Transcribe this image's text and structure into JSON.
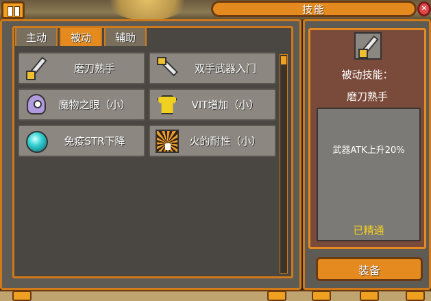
{
  "window": {
    "title": "技能"
  },
  "tabs": [
    {
      "label": "主动",
      "active": false
    },
    {
      "label": "被动",
      "active": true
    },
    {
      "label": "辅助",
      "active": false
    }
  ],
  "skills": [
    {
      "name": "磨刀熟手",
      "icon": "sword-icon"
    },
    {
      "name": "双手武器入门",
      "icon": "two-hand-sword-icon"
    },
    {
      "name": "魔物之眼（小）",
      "icon": "monster-eye-icon"
    },
    {
      "name": "VIT增加（小）",
      "icon": "shirt-icon"
    },
    {
      "name": "免疫STR下降",
      "icon": "orb-icon"
    },
    {
      "name": "火的耐性（小）",
      "icon": "fire-icon"
    }
  ],
  "detail": {
    "type_label": "被动技能：",
    "skill_name": "磨刀熟手",
    "description": "武器ATK上升20%",
    "status": "已精通",
    "equip_label": "装备"
  },
  "colors": {
    "accent": "#e48a1e",
    "panel": "#5e5a54",
    "status": "#f5d020",
    "close": "#e04848"
  }
}
